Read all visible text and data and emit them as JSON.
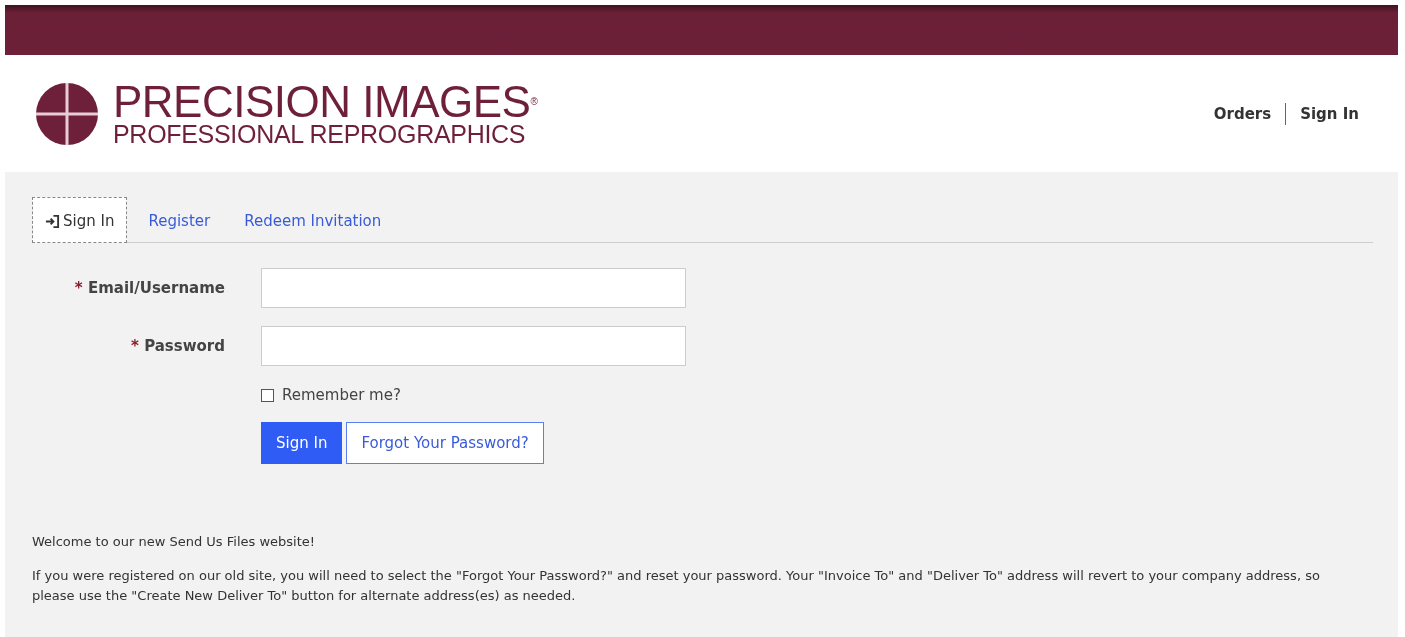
{
  "logo": {
    "title": "PRECISION IMAGES$^{®}$",
    "subtitle": "PROFESSIONAL REPROGRAPHICS"
  },
  "nav": [
    {
      "label": "Orders"
    },
    {
      "label": "Sign In"
    }
  ],
  "tabs": [
    {
      "label": "Sign In",
      "selected": true,
      "kind": "icon"
    },
    {
      "label": "Register",
      "selected": false,
      "kind": "plain"
    },
    {
      "label": "Redeem Invitation",
      "selected": false,
      "kind": "plain"
    }
  ],
  "fields": [
    {
      "label": "Email/Username",
      "required": "*"
    },
    {
      "label": "Password",
      "required": "*"
    }
  ],
  "remember": {
    "label": "Remember me?",
    "checked": false
  },
  "buttons": [
    {
      "label": "Sign In",
      "kind": "primary"
    },
    {
      "label": "Forgot Your Password?",
      "kind": "outline"
    }
  ],
  "messages": [
    "Welcome to our new Send Us Files website!",
    "If you were registered on our old site, you will need to select the \"Forgot Your Password?\" and reset your password. Your \"Invoice To\" and \"Deliver To\" address will revert to your company address, so please use the \"Create New Deliver To\" button for alternate address(es) as needed."
  ]
}
